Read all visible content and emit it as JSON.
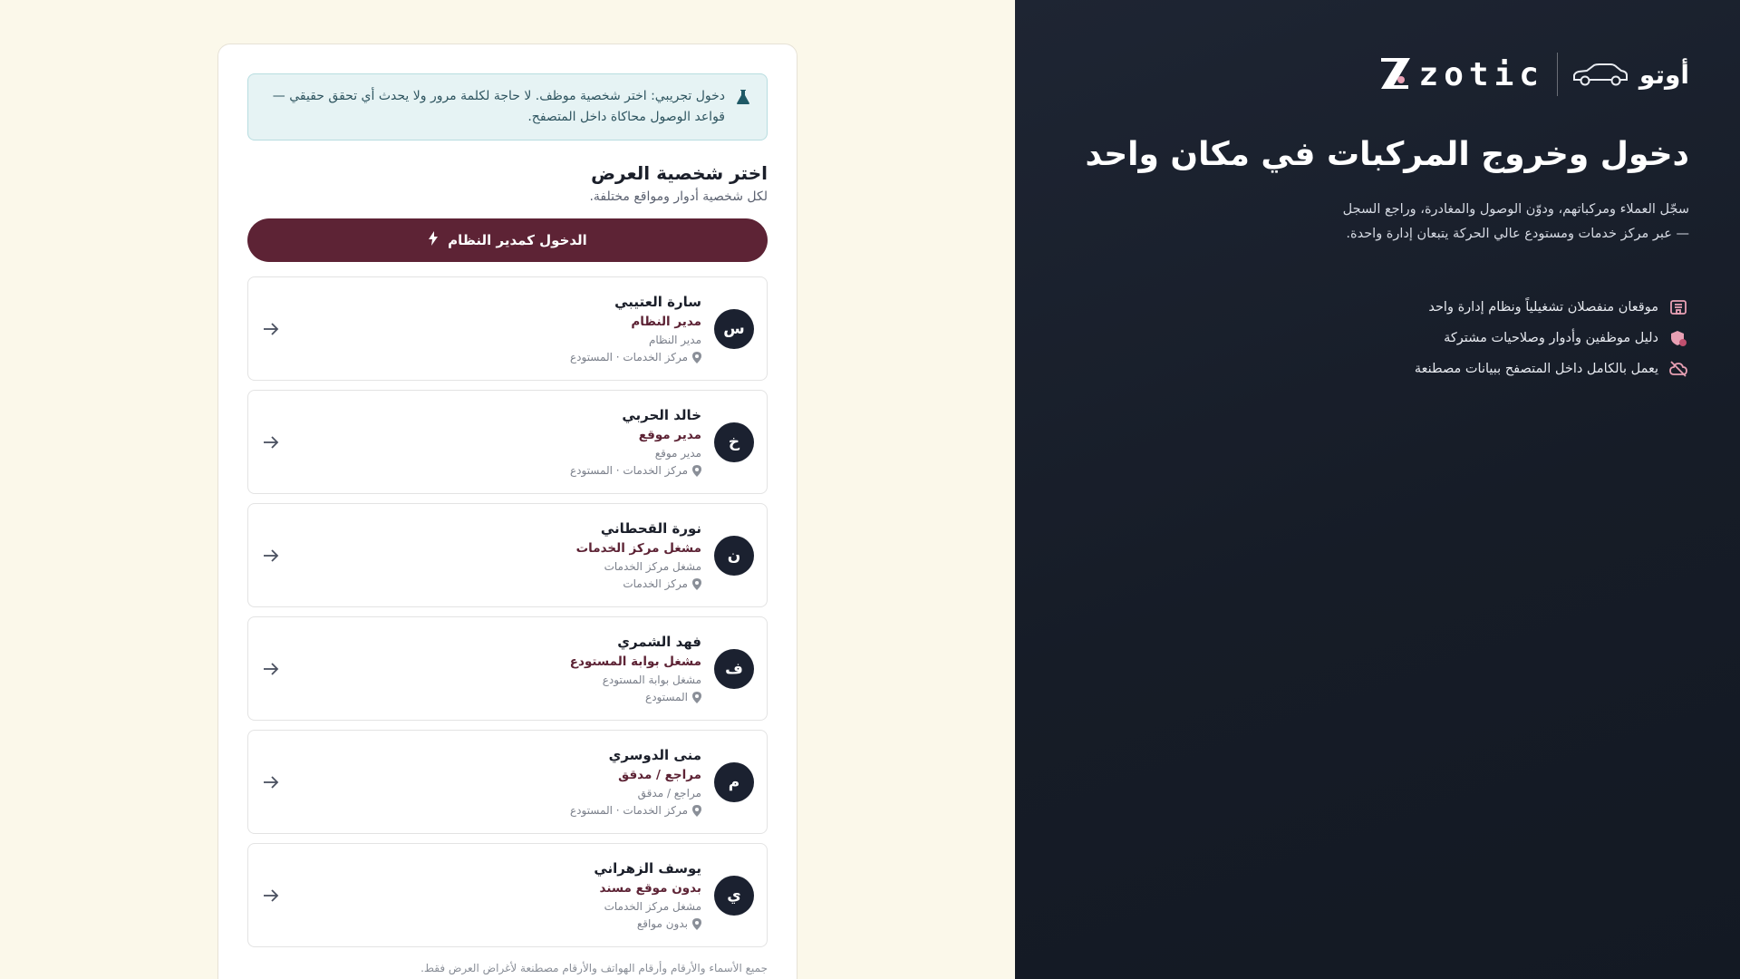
{
  "brand": {
    "app_name": "أوتو",
    "logo_text": "zotic",
    "headline": "دخول وخروج المركبات في مكان واحد",
    "description": "سجّل العملاء ومركباتهم، ودوّن الوصول والمغادرة، وراجع السجل — عبر مركز خدمات ومستودع عالي الحركة يتبعان إدارة واحدة.",
    "features": [
      {
        "icon": "building-icon",
        "text": "موقعان منفصلان تشغيلياً ونظام إدارة واحد"
      },
      {
        "icon": "shield-user-icon",
        "text": "دليل موظفين وأدوار وصلاحيات مشتركة"
      },
      {
        "icon": "cloud-off-icon",
        "text": "يعمل بالكامل داخل المتصفح ببيانات مصطنعة"
      }
    ],
    "accent": "#e8a0b4"
  },
  "login": {
    "notice": "دخول تجريبي: اختر شخصية موظف. لا حاجة لكلمة مرور ولا يحدث أي تحقق حقيقي — قواعد الوصول محاكاة داخل المتصفح.",
    "title": "اختر شخصية العرض",
    "subtitle": "لكل شخصية أدوار ومواقع مختلفة.",
    "admin_button": "الدخول كمدير النظام",
    "footnote": "جميع الأسماء والأرقام وأرقام الهواتف والأرقام مصطنعة لأغراض العرض فقط.",
    "accent": "#5d2335"
  },
  "personas": [
    {
      "initial": "س",
      "name": "سارة العتيبي",
      "role": "مدير النظام",
      "subrole": "مدير النظام",
      "location": "مركز الخدمات · المستودع"
    },
    {
      "initial": "خ",
      "name": "خالد الحربي",
      "role": "مدير موقع",
      "subrole": "مدير موقع",
      "location": "مركز الخدمات · المستودع"
    },
    {
      "initial": "ن",
      "name": "نورة القحطاني",
      "role": "مشغل مركز الخدمات",
      "subrole": "مشغل مركز الخدمات",
      "location": "مركز الخدمات"
    },
    {
      "initial": "ف",
      "name": "فهد الشمري",
      "role": "مشغل بوابة المستودع",
      "subrole": "مشغل بوابة المستودع",
      "location": "المستودع"
    },
    {
      "initial": "م",
      "name": "منى الدوسري",
      "role": "مراجع / مدقق",
      "subrole": "مراجع / مدقق",
      "location": "مركز الخدمات · المستودع"
    },
    {
      "initial": "ي",
      "name": "يوسف الزهراني",
      "role": "بدون موقع مسند",
      "subrole": "مشغل مركز الخدمات",
      "location": "بدون مواقع"
    }
  ]
}
